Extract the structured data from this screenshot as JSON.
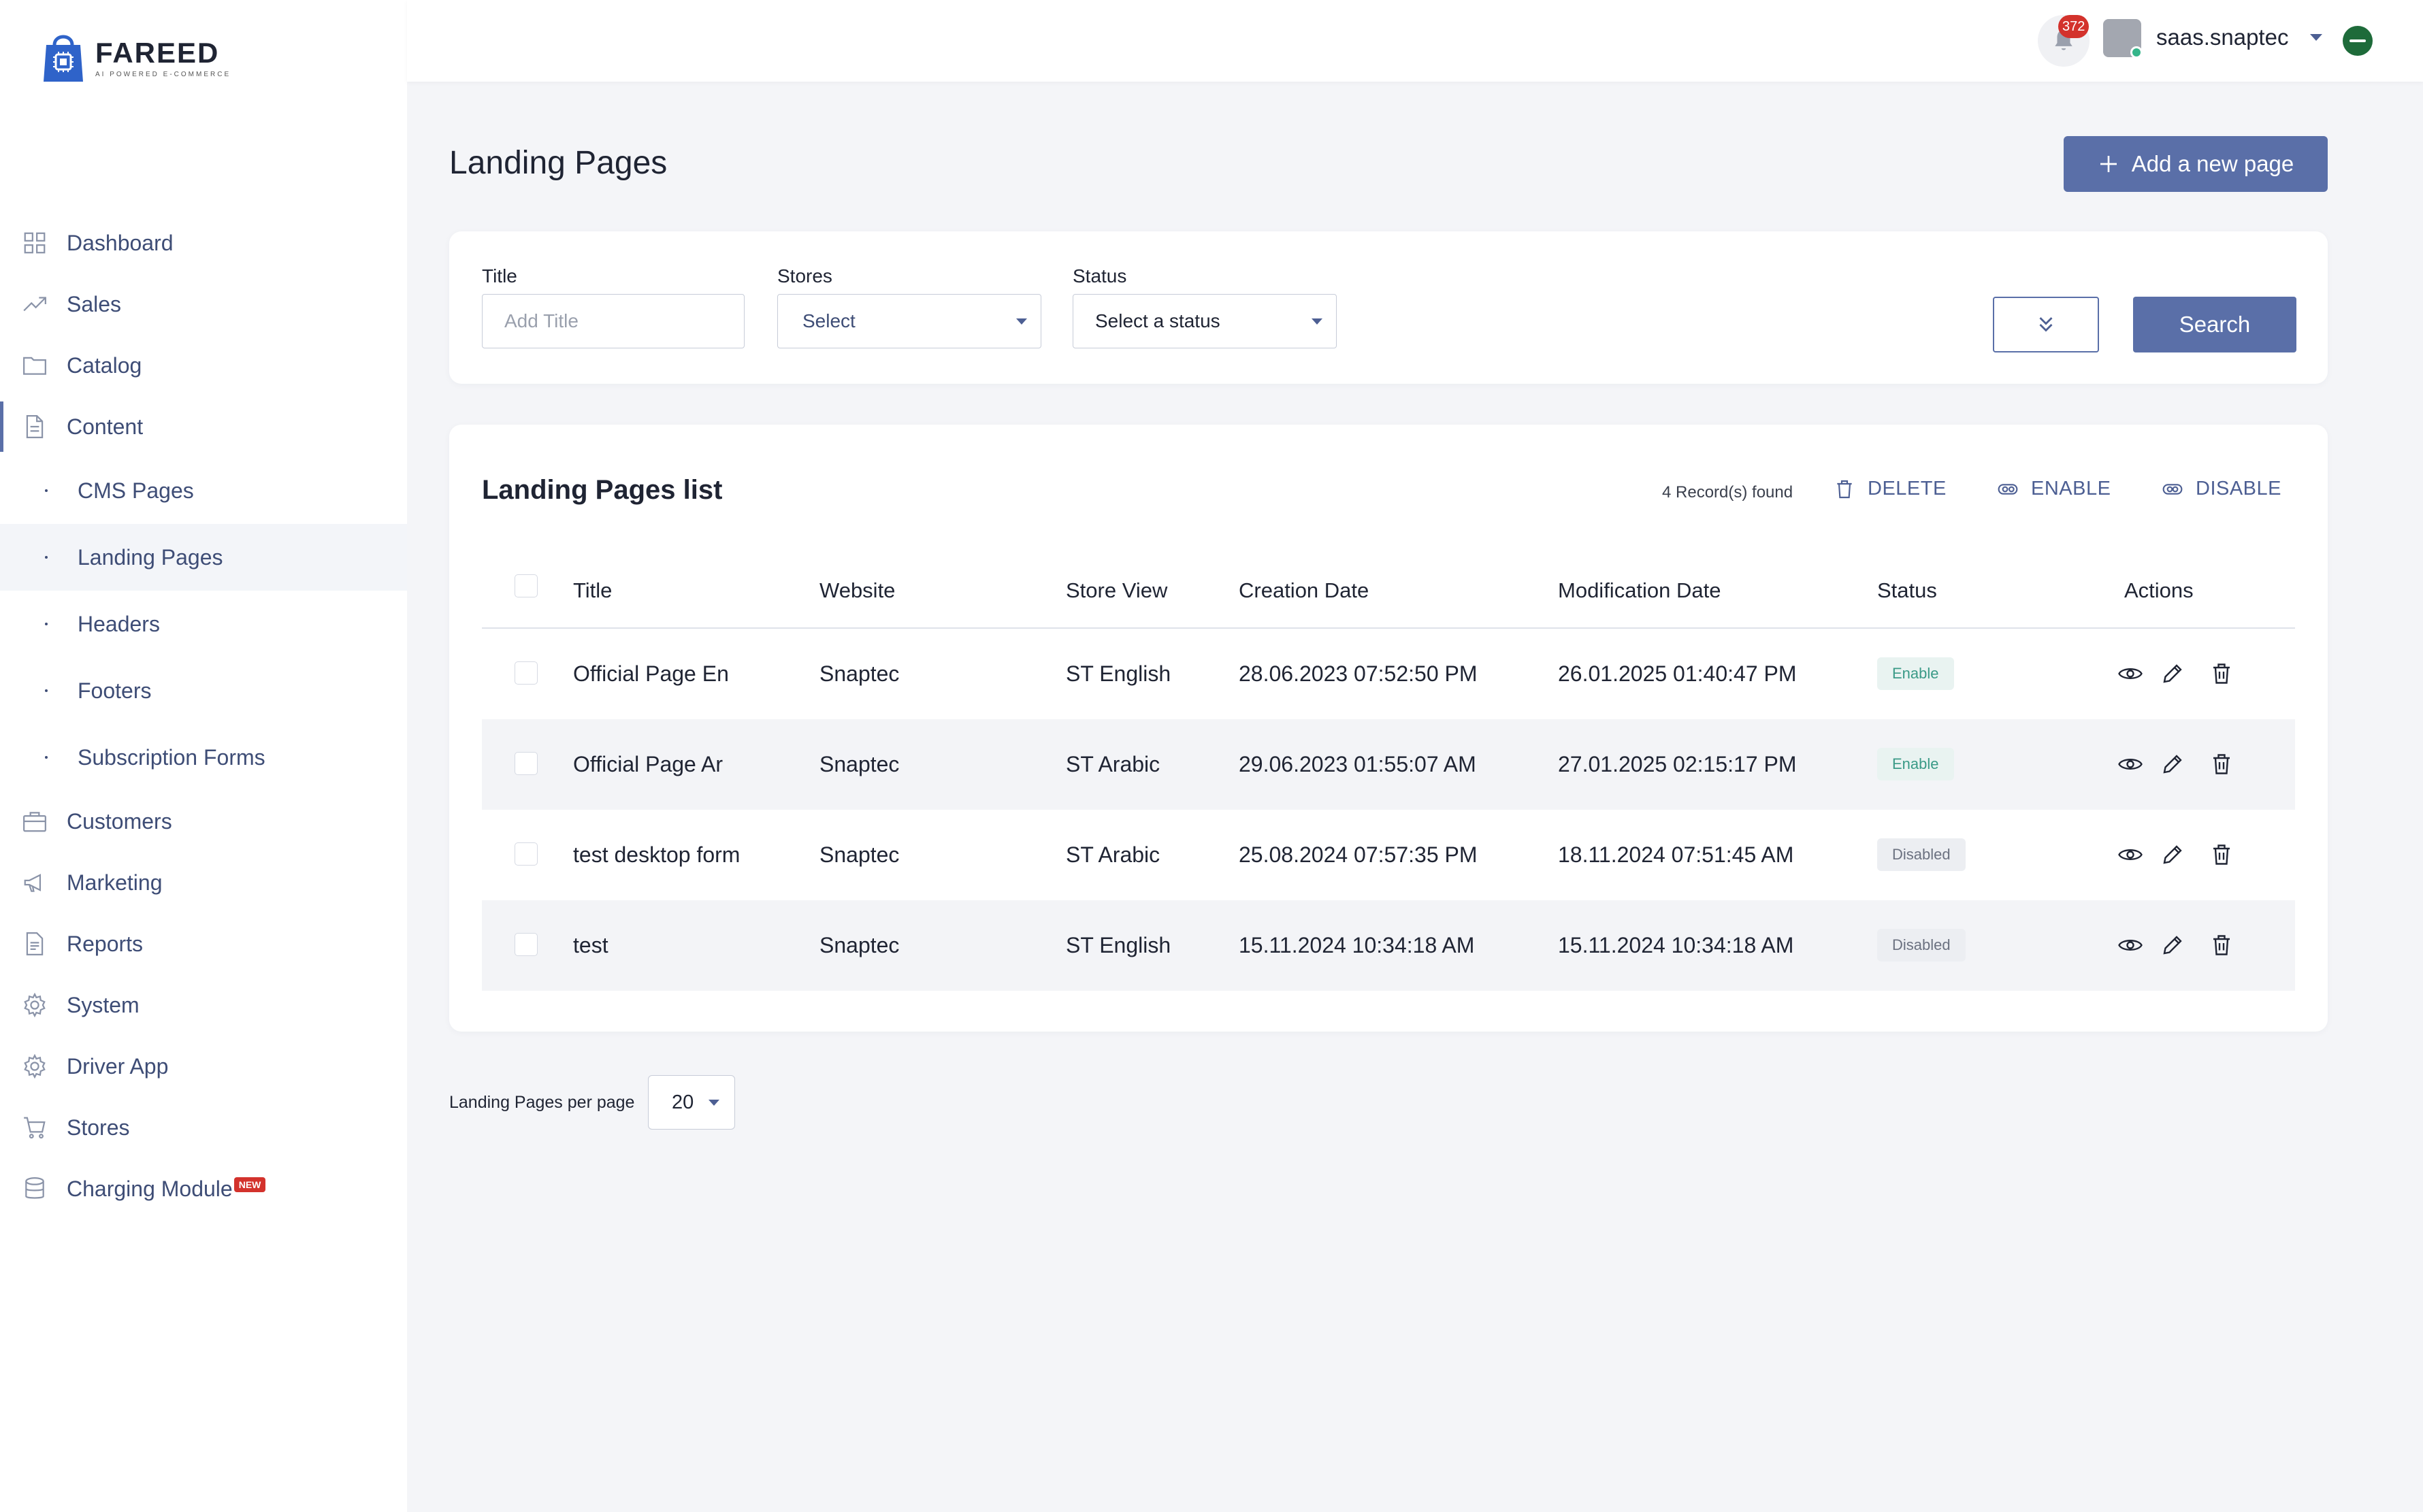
{
  "brand": {
    "name": "FAREED",
    "tagline": "AI POWERED E-COMMERCE"
  },
  "sidebar": {
    "items": [
      {
        "label": "Dashboard",
        "icon": "grid-icon"
      },
      {
        "label": "Sales",
        "icon": "trending-up-icon"
      },
      {
        "label": "Catalog",
        "icon": "folder-icon"
      },
      {
        "label": "Content",
        "icon": "document-icon",
        "active": true
      },
      {
        "label": "Customers",
        "icon": "briefcase-icon"
      },
      {
        "label": "Marketing",
        "icon": "megaphone-icon"
      },
      {
        "label": "Reports",
        "icon": "report-icon"
      },
      {
        "label": "System",
        "icon": "gear-icon"
      },
      {
        "label": "Driver App",
        "icon": "gear-icon"
      },
      {
        "label": "Stores",
        "icon": "cart-icon"
      },
      {
        "label": "Charging Module",
        "icon": "database-icon",
        "badge": "NEW"
      }
    ],
    "content_sub": [
      {
        "label": "CMS Pages"
      },
      {
        "label": "Landing Pages",
        "active": true
      },
      {
        "label": "Headers"
      },
      {
        "label": "Footers"
      },
      {
        "label": "Subscription Forms"
      }
    ]
  },
  "topbar": {
    "notifications": "372",
    "username": "saas.snaptec"
  },
  "page": {
    "title": "Landing Pages",
    "add_label": "Add a new page"
  },
  "filters": {
    "title_label": "Title",
    "title_placeholder": "Add Title",
    "stores_label": "Stores",
    "stores_value": "Select",
    "status_label": "Status",
    "status_value": "Select a status",
    "search_label": "Search"
  },
  "list": {
    "title": "Landing Pages list",
    "records": "4 Record(s) found",
    "delete_label": "DELETE",
    "enable_label": "ENABLE",
    "disable_label": "DISABLE",
    "columns": [
      "Title",
      "Website",
      "Store View",
      "Creation Date",
      "Modification Date",
      "Status",
      "Actions"
    ],
    "rows": [
      {
        "title": "Official Page En",
        "website": "Snaptec",
        "store_view": "ST English",
        "created": "28.06.2023 07:52:50 PM",
        "modified": "26.01.2025 01:40:47 PM",
        "status": "Enable"
      },
      {
        "title": "Official Page Ar",
        "website": "Snaptec",
        "store_view": "ST Arabic",
        "created": "29.06.2023 01:55:07 AM",
        "modified": "27.01.2025 02:15:17 PM",
        "status": "Enable"
      },
      {
        "title": "test desktop form",
        "website": "Snaptec",
        "store_view": "ST Arabic",
        "created": "25.08.2024 07:57:35 PM",
        "modified": "18.11.2024 07:51:45 AM",
        "status": "Disabled"
      },
      {
        "title": "test",
        "website": "Snaptec",
        "store_view": "ST English",
        "created": "15.11.2024 10:34:18 AM",
        "modified": "15.11.2024 10:34:18 AM",
        "status": "Disabled"
      }
    ]
  },
  "pagination": {
    "per_page_label": "Landing Pages per page",
    "per_page_value": "20"
  },
  "colors": {
    "accent": "#5a6fa8",
    "nav_text": "#3e4d76",
    "enable_bg": "#e9f3f1",
    "enable_text": "#3a9a87",
    "disabled_bg": "#eceef2",
    "badge_red": "#d3322c"
  }
}
